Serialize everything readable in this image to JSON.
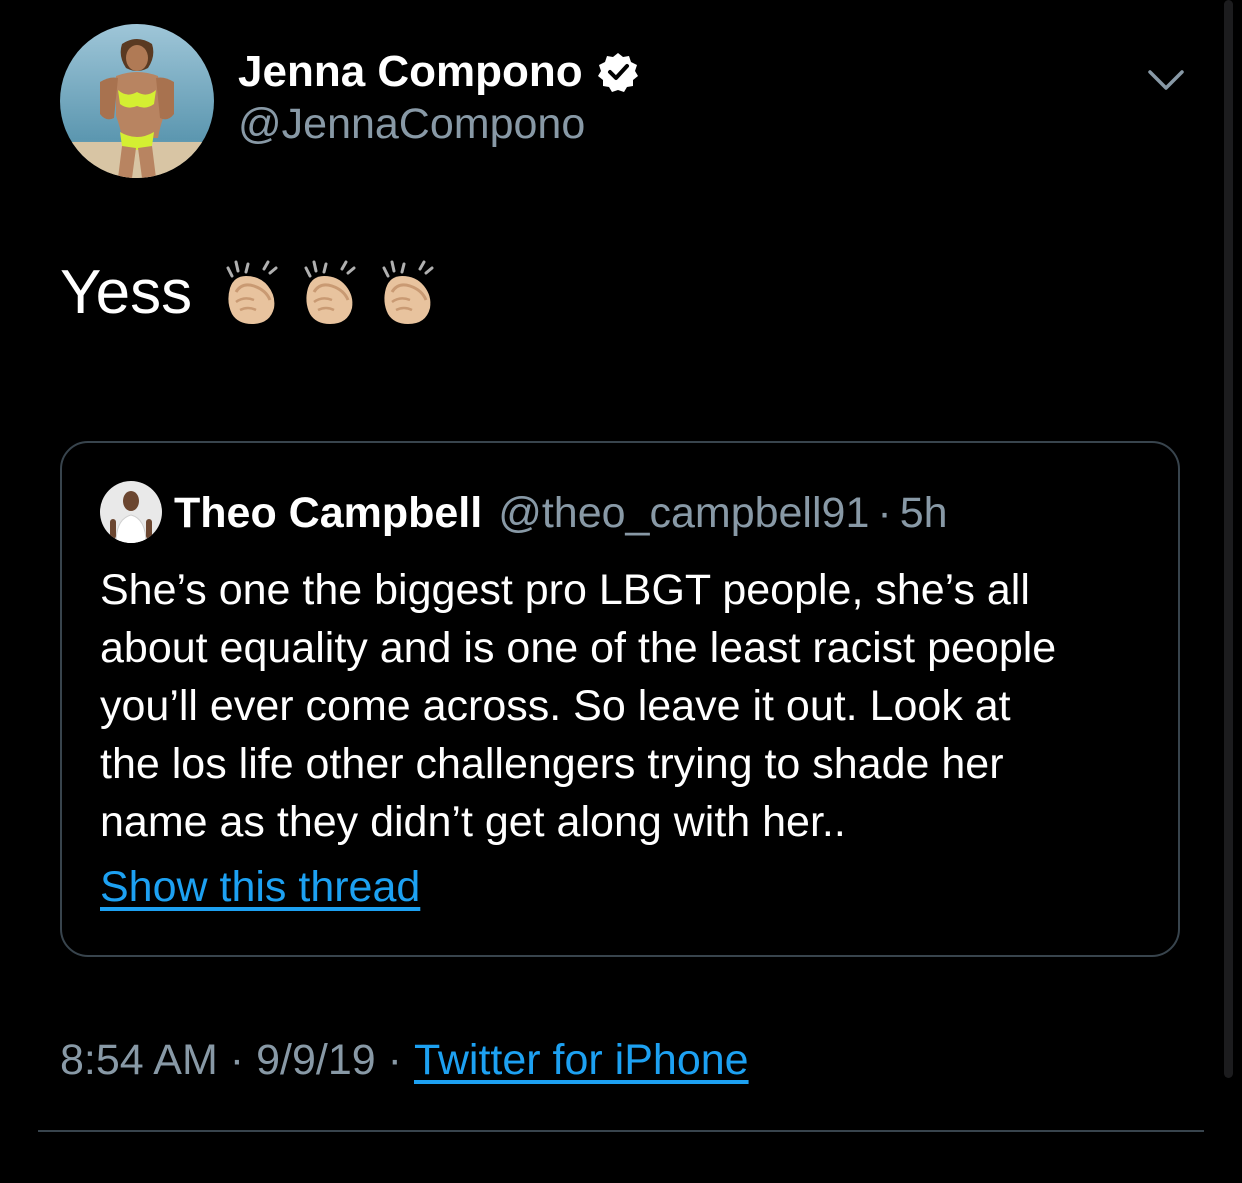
{
  "author": {
    "display_name": "Jenna Compono",
    "handle": "@JennaCompono",
    "verified": true
  },
  "tweet": {
    "text": "Yess",
    "emojis": [
      "clapping-hands-icon",
      "clapping-hands-icon",
      "clapping-hands-icon"
    ]
  },
  "quoted_tweet": {
    "display_name": "Theo Campbell",
    "handle": "@theo_campbell91",
    "separator": "·",
    "time": "5h",
    "lines": [
      "She’s one the biggest pro LBGT people, she’s all",
      "about equality and is one of the least racist people",
      "you’ll ever come across. So leave it out. Look at",
      "the los life other challengers trying to shade her",
      "name as they didn’t get along with her.."
    ],
    "show_thread": "Show this thread"
  },
  "meta": {
    "time": "8:54 AM",
    "separator": "·",
    "date": "9/9/19",
    "source": "Twitter for iPhone"
  },
  "colors": {
    "background": "#000000",
    "secondary_text": "#8899a6",
    "link": "#1da1f2",
    "border": "#38444d"
  }
}
